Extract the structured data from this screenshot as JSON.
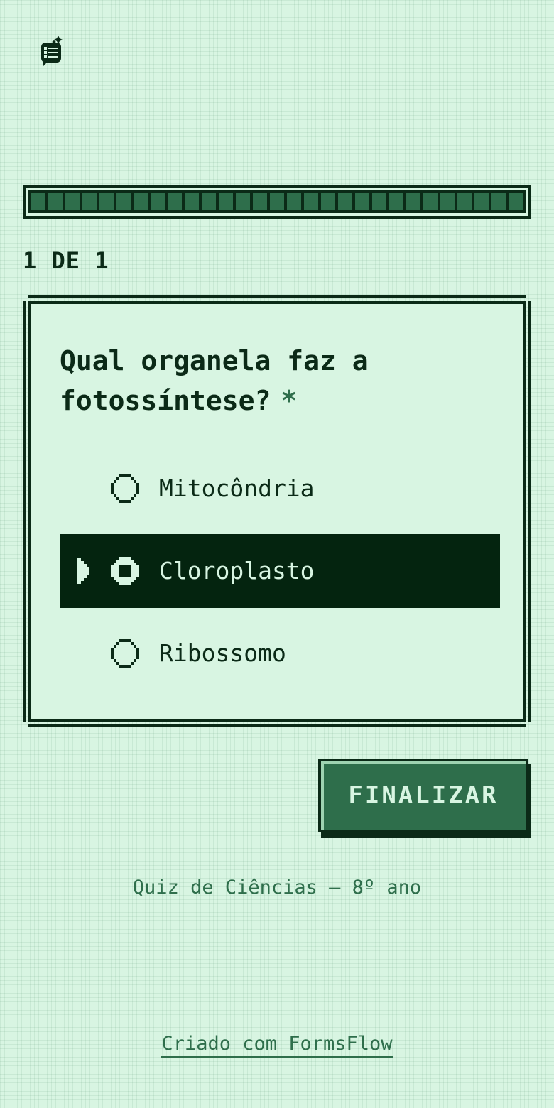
{
  "logo": {
    "icon": "form-sparkle-icon"
  },
  "progress": {
    "fraction": 1.0,
    "segments": 29
  },
  "counter": "1 DE 1",
  "question": {
    "text": "Qual organela faz a fotossíntese?",
    "required_mark": "*",
    "options": [
      {
        "label": "Mitocôndria",
        "selected": false
      },
      {
        "label": "Cloroplasto",
        "selected": true
      },
      {
        "label": "Ribossomo",
        "selected": false
      }
    ]
  },
  "submit_label": "FINALIZAR",
  "quiz_title": "Quiz de Ciências — 8º ano",
  "footer_link": "Criado com FormsFlow",
  "colors": {
    "background": "#d8f5e2",
    "ink": "#0b2a17",
    "accent": "#2e6e4b",
    "selected_bg": "#04240f"
  }
}
